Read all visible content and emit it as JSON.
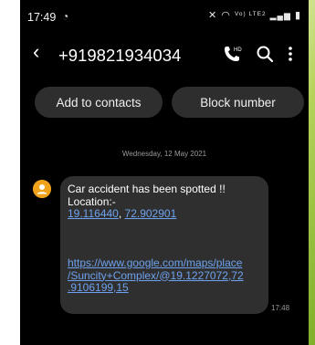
{
  "status_bar": {
    "time": "17:49",
    "notification_icon": "whatsapp-icon",
    "volte_label": "Vo) LTE2",
    "icons": [
      "mute-icon",
      "wifi-icon",
      "signal-icon",
      "battery-icon"
    ]
  },
  "header": {
    "back_icon": "back-chevron-icon",
    "contact_number": "+919821934034",
    "action_icons": [
      "hd-call-icon",
      "search-icon",
      "more-vertical-icon"
    ]
  },
  "actions": {
    "add_to_contacts": "Add to contacts",
    "block_number": "Block number"
  },
  "date_separator": "Wednesday, 12 May 2021",
  "message": {
    "line1": "Car accident has been spotted !!",
    "line2": "Location:-",
    "latitude": "19.116440",
    "comma": ",",
    "longitude": "72.902901",
    "url_lines": [
      "https://www.google.com/maps/place",
      "/Suncity+Complex/@19.1227072,72",
      ".9106199,15"
    ],
    "time": "17:48"
  },
  "colors": {
    "background": "#000000",
    "bubble": "#2f2f2f",
    "button": "#2e2e2e",
    "link": "#6ea2ef",
    "avatar": "#f0a21b"
  }
}
